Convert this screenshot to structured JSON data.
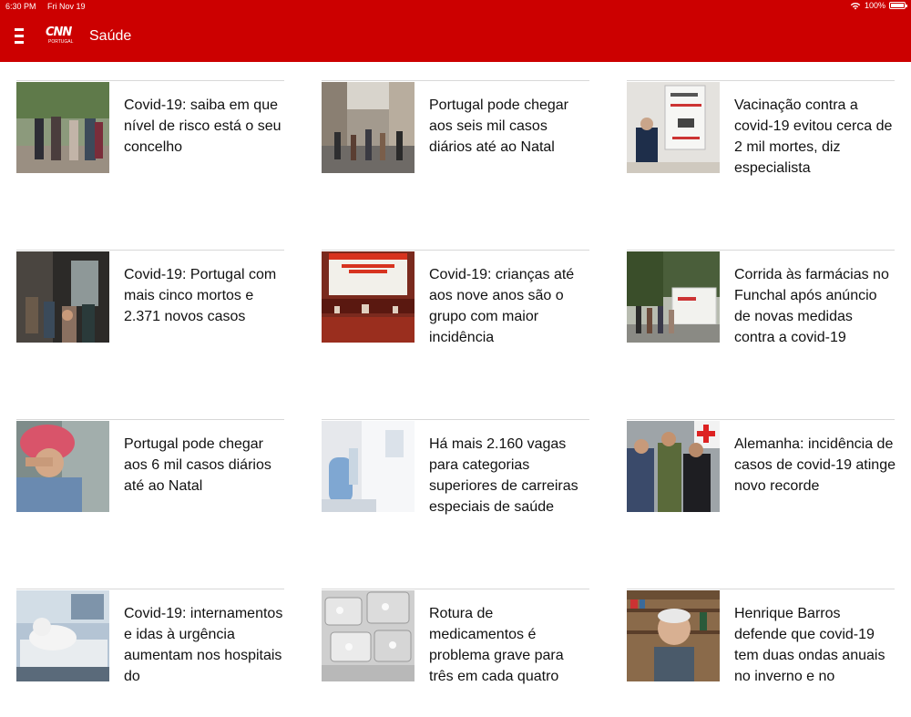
{
  "status_bar": {
    "time": "6:30 PM",
    "date": "Fri Nov 19",
    "battery": "100%",
    "icons": [
      "wifi-icon",
      "battery-icon"
    ]
  },
  "header": {
    "menu_icon": "hamburger-menu-icon",
    "logo_text": "CNN",
    "logo_subtext": "PORTUGAL",
    "section_title": "Saúde",
    "brand_color": "#cc0000"
  },
  "articles": [
    {
      "headline": "Covid-19: saiba em que nível de risco está o seu concelho"
    },
    {
      "headline": "Portugal pode chegar aos seis mil casos diários até ao Natal"
    },
    {
      "headline": "Vacinação contra a covid-19 evitou cerca de 2 mil mortes, diz especialista"
    },
    {
      "headline": "Covid-19: Portugal com mais cinco mortos e 2.371 novos casos"
    },
    {
      "headline": "Covid-19: crianças até aos nove anos são o grupo com maior incidência"
    },
    {
      "headline": "Corrida às farmácias no Funchal após anúncio de novas medidas contra a covid-19"
    },
    {
      "headline": "Portugal pode chegar aos 6 mil casos diários até ao Natal"
    },
    {
      "headline": "Há mais 2.160 vagas para categorias superiores de carreiras especiais de saúde"
    },
    {
      "headline": "Alemanha: incidência de casos de covid-19 atinge novo recorde"
    },
    {
      "headline": "Covid-19: internamentos e idas à urgência aumentam nos hospitais do"
    },
    {
      "headline": "Rotura de medicamentos é problema grave para três em cada quatro"
    },
    {
      "headline": "Henrique Barros defende que covid-19 tem duas ondas anuais no inverno e no"
    }
  ]
}
